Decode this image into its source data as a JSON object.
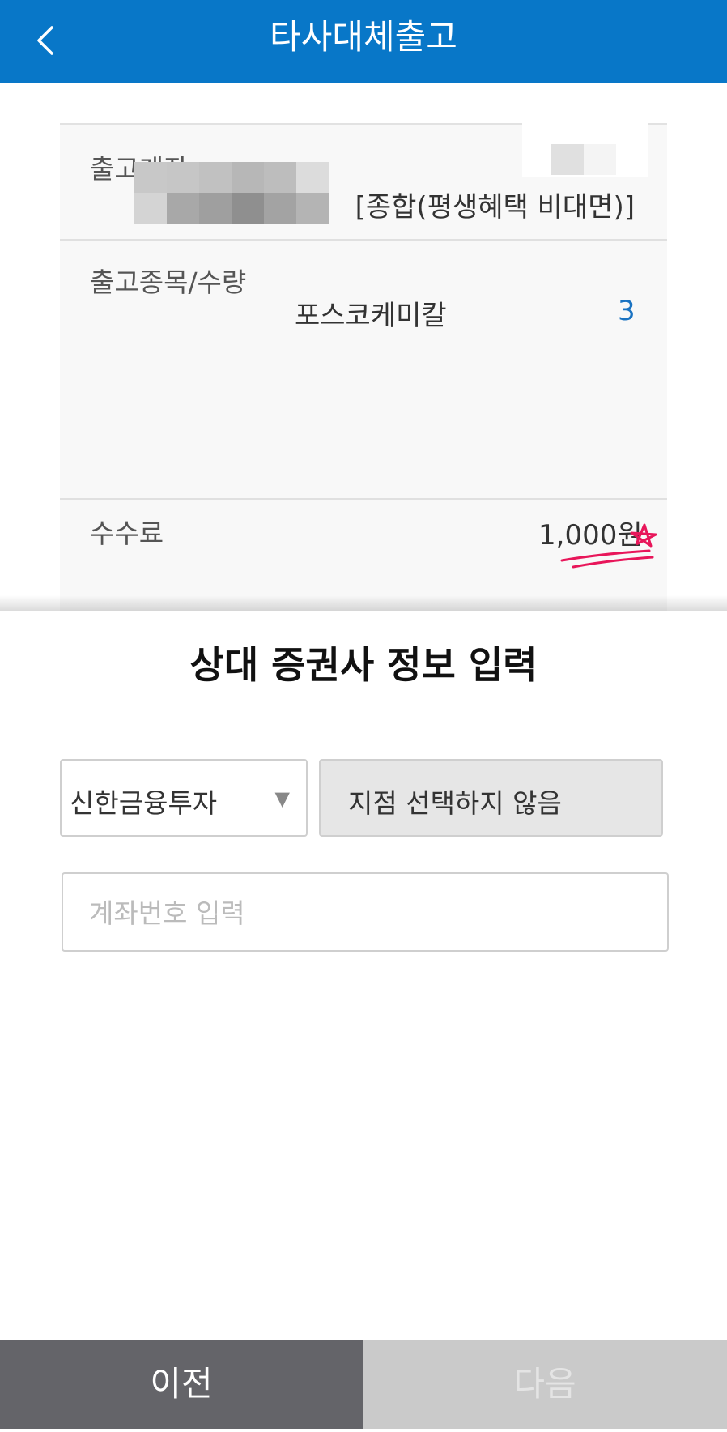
{
  "header": {
    "title": "타사대체출고",
    "back_icon": "chevron-left-icon"
  },
  "info": {
    "account_label": "출고계좌",
    "account_type": "[종합(평생혜택 비대면)]",
    "stock_label": "출고종목/수량",
    "stock_name": "포스코케미칼",
    "stock_qty": "3",
    "fee_label": "수수료",
    "fee_value": "1,000원"
  },
  "form": {
    "title": "상대 증권사 정보 입력",
    "broker_selected": "신한금융투자",
    "branch_text": "지점 선택하지 않음",
    "account_placeholder": "계좌번호 입력"
  },
  "footer": {
    "prev_label": "이전",
    "next_label": "다음"
  },
  "colors": {
    "header_bg": "#0877c8",
    "qty_color": "#1a73c2",
    "annotation": "#e8165a"
  }
}
